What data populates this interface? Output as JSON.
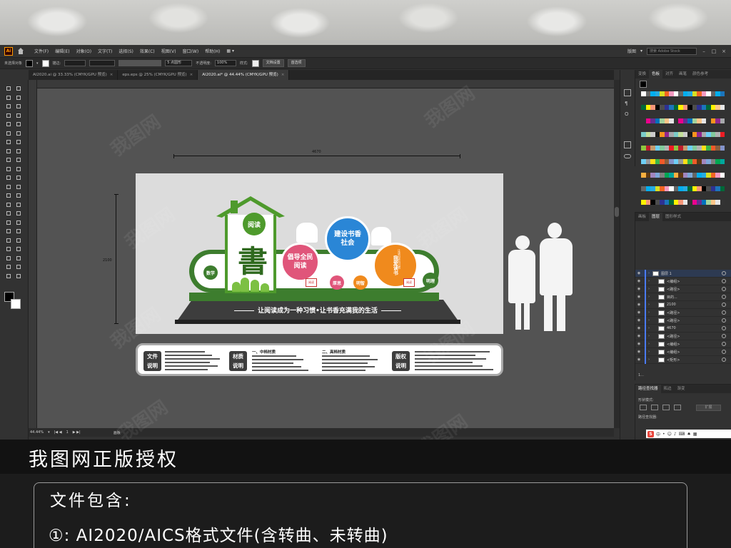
{
  "app": {
    "logo": "Ai",
    "menu": [
      "文件(F)",
      "编辑(E)",
      "对象(O)",
      "文字(T)",
      "选择(S)",
      "效果(C)",
      "视图(V)",
      "窗口(W)",
      "帮助(H)"
    ],
    "workspace": "版图",
    "search_placeholder": "搜索 Adobe Stock"
  },
  "control": {
    "selection": "未选择对象",
    "stroke_label": "描边:",
    "brush": "5 点圆形",
    "opacity_label": "不透明度:",
    "opacity_value": "100%",
    "style_label": "样式:",
    "doc_settings": "文档设置",
    "preferences": "首选项"
  },
  "tabs": [
    {
      "label": "AI2020.ai @ 33.33% (CMYK/GPU 预览)",
      "active": false
    },
    {
      "label": "eps.eps @ 25% (CMYK/GPU 预览)",
      "active": false
    },
    {
      "label": "AI2020.ai* @ 44.44% (CMYK/GPU 预览)",
      "active": true
    }
  ],
  "status": {
    "zoom": "44.44%",
    "artboard": "1",
    "mode": "画板"
  },
  "panels": {
    "swatch_tabs": [
      "变换",
      "色板",
      "对齐",
      "画笔",
      "颜色参考"
    ],
    "layer_tabs": [
      "画板",
      "图层",
      "图形样式"
    ],
    "layers": [
      {
        "name": "图层 1",
        "level": 0
      },
      {
        "name": "<编组>",
        "level": 1
      },
      {
        "name": "<路径>",
        "level": 1
      },
      {
        "name": "目的...",
        "level": 1
      },
      {
        "name": "2100",
        "level": 1
      },
      {
        "name": "<路径>",
        "level": 1
      },
      {
        "name": "<路径>",
        "level": 1
      },
      {
        "name": "4670",
        "level": 1
      },
      {
        "name": "<路径>",
        "level": 1
      },
      {
        "name": "<编组>",
        "level": 1
      },
      {
        "name": "<编组>",
        "level": 1
      },
      {
        "name": "<矩形>",
        "level": 1
      }
    ],
    "layers_footer": "1...",
    "path_tabs": [
      "路径查找器",
      "拓边",
      "渐变"
    ],
    "shape_mode": "形状模式:",
    "pathfinder": "路径查找器:",
    "expand": "扩展"
  },
  "artwork": {
    "width_dim": "4670",
    "height_dim": "2100",
    "house_badge": "阅读",
    "big_char": "書",
    "left_small": "数学",
    "circle_pink": "倡导全民\n阅读",
    "circle_blue": "建设书香\n社会",
    "circle_orange": "我爱读书",
    "circle_orange_note": "让读书成为习惯",
    "small_circle_1": "厚思",
    "small_circle_2": "明智",
    "small_circle_right": "明理",
    "book_text": "阅读",
    "slogan": "让阅读成为一种习惯•让书香充满我的生活",
    "info_labels": [
      "文件\n说明",
      "材质\n说明",
      "版权\n说明"
    ],
    "info_sub_1": "一、中档材质",
    "info_sub_2": "二、高档材质"
  },
  "banner": {
    "title": "我图网正版授权",
    "contents_title": "文件包含:",
    "contents_item": "①: AI2020/AICS格式文件(含转曲、未转曲)"
  },
  "watermark": "我图网",
  "colors": {
    "green": "#4e9a2c",
    "dark_green": "#3d7d2e",
    "pink": "#e0557a",
    "blue": "#2a86d6",
    "orange": "#f08a1d"
  }
}
